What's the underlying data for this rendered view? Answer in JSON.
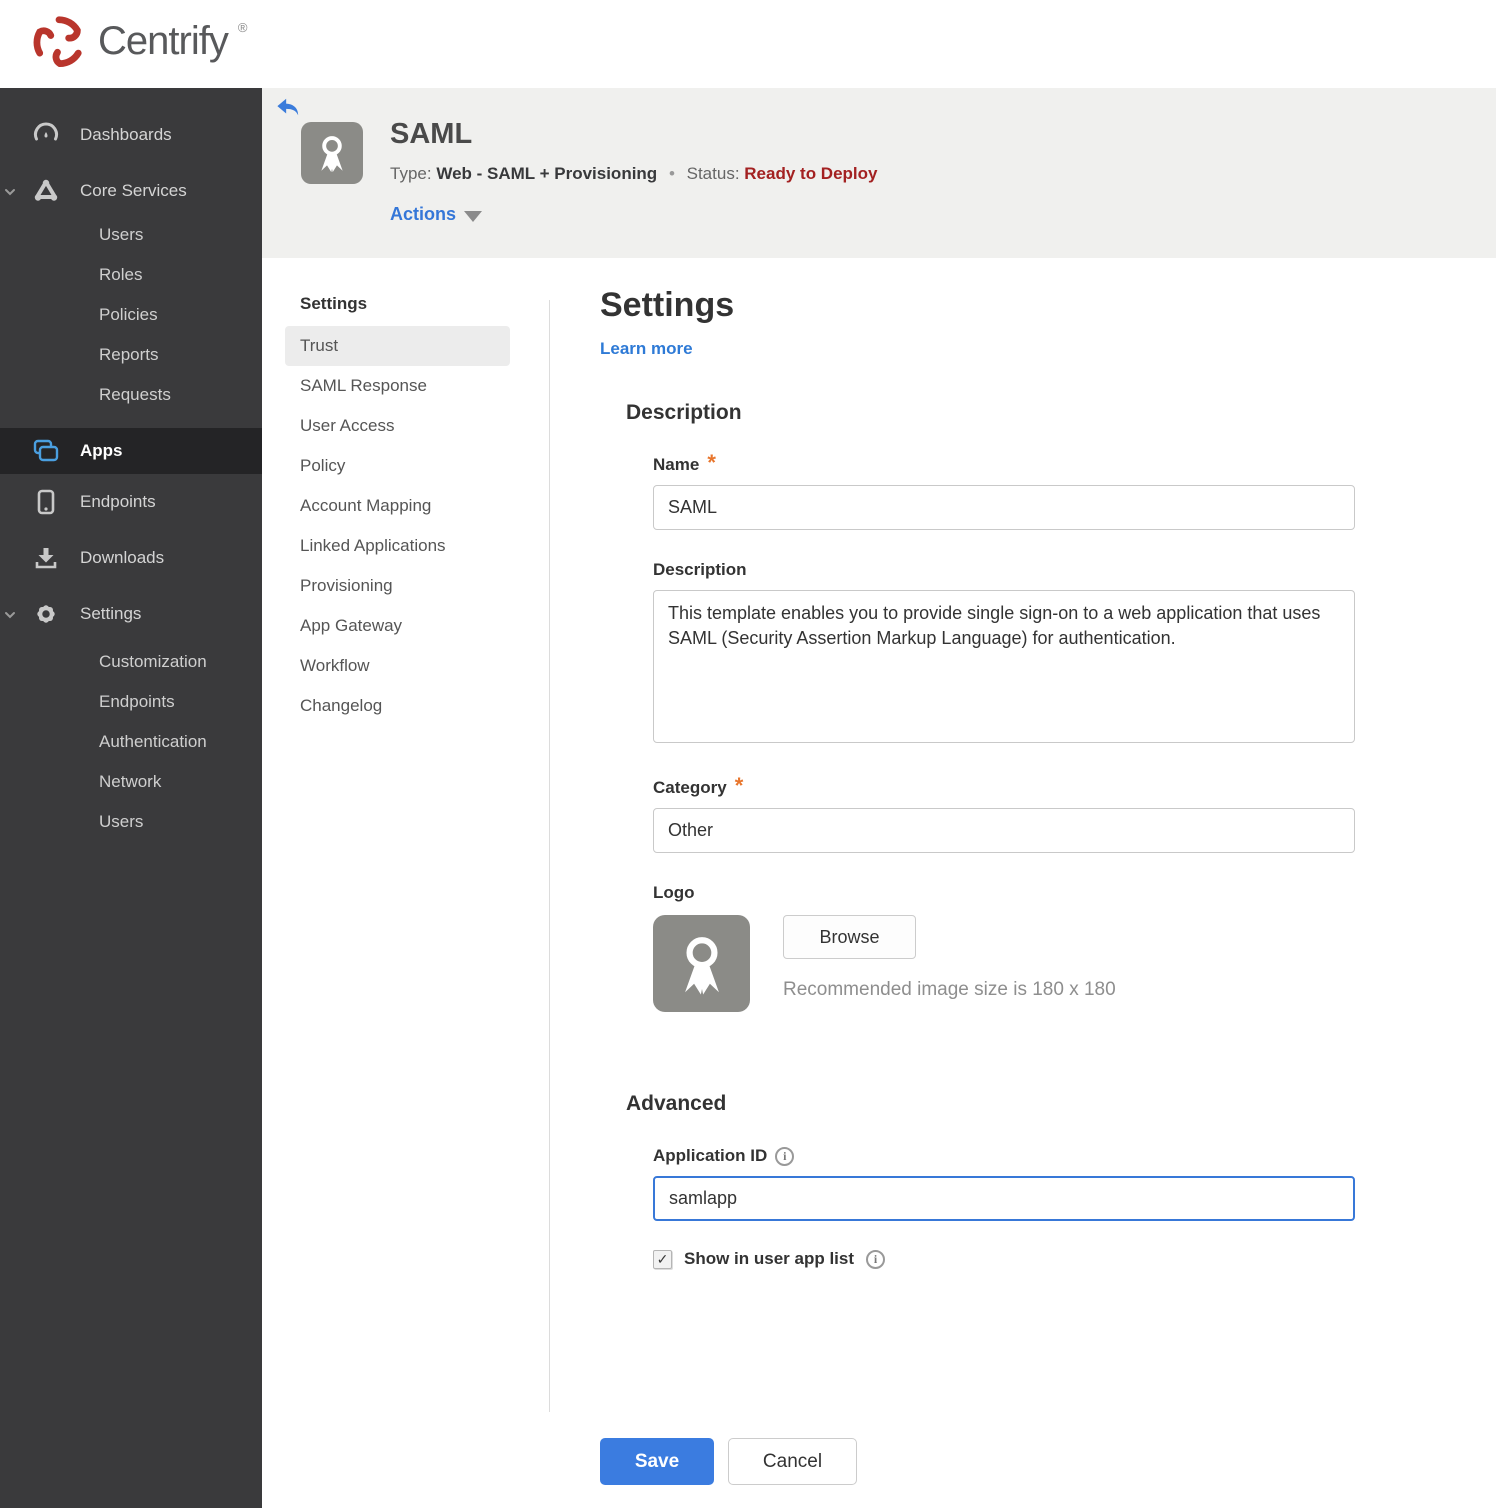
{
  "brand": {
    "name": "Centrify",
    "reg_mark": "®"
  },
  "sidebar": {
    "dashboards": "Dashboards",
    "core_services": "Core Services",
    "core_children": [
      "Users",
      "Roles",
      "Policies",
      "Reports",
      "Requests"
    ],
    "apps": "Apps",
    "endpoints": "Endpoints",
    "downloads": "Downloads",
    "settings": "Settings",
    "settings_children": [
      "Customization",
      "Endpoints",
      "Authentication",
      "Network",
      "Users"
    ]
  },
  "app_header": {
    "title": "SAML",
    "type_label": "Type:",
    "type_value": "Web - SAML + Provisioning",
    "separator": "•",
    "status_label": "Status:",
    "status_value": "Ready to Deploy",
    "actions_label": "Actions"
  },
  "subnav": {
    "heading": "Settings",
    "active_item": "Trust",
    "items": [
      "Trust",
      "SAML Response",
      "User Access",
      "Policy",
      "Account Mapping",
      "Linked Applications",
      "Provisioning",
      "App Gateway",
      "Workflow",
      "Changelog"
    ]
  },
  "main": {
    "title": "Settings",
    "learn_more": "Learn more",
    "required_marker": "*",
    "description_section": {
      "heading": "Description",
      "name_label": "Name",
      "name_value": "SAML",
      "description_label": "Description",
      "description_value": "This template enables you to provide single sign-on to a web application that uses SAML (Security Assertion Markup Language) for authentication.",
      "category_label": "Category",
      "category_value": "Other",
      "logo_label": "Logo",
      "browse_label": "Browse",
      "logo_hint": "Recommended image size is 180 x 180"
    },
    "advanced_section": {
      "heading": "Advanced",
      "app_id_label": "Application ID",
      "app_id_value": "samlapp",
      "show_label": "Show in user app list",
      "checkbox_checked": true
    },
    "footer": {
      "save_label": "Save",
      "cancel_label": "Cancel"
    }
  },
  "icons": {
    "info_glyph": "i",
    "check_glyph": "✓"
  },
  "colors": {
    "accent_blue": "#3b7ce0",
    "link_blue": "#2e7ad6",
    "status_red": "#a32121",
    "required_orange": "#e8762d",
    "sidebar_bg": "#3a3a3c",
    "sidebar_active_bg": "#242426",
    "header_bg": "#f0f0ee",
    "logo_red": "#b9352c",
    "app_tile_gray": "#8b8b87"
  }
}
